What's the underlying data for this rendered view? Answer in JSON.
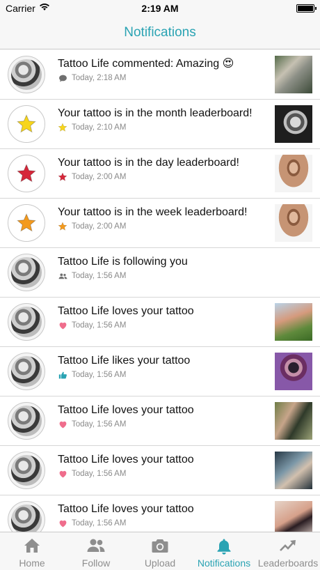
{
  "status_bar": {
    "carrier": "Carrier",
    "time": "2:19 AM"
  },
  "nav": {
    "title": "Notifications"
  },
  "notifications": [
    {
      "message": "Tattoo Life commented: Amazing 😍",
      "time": "Today, 2:18 AM",
      "meta_icon": "comment-icon",
      "avatar": "profile-photo",
      "thumb": "tattoo-arm-photo"
    },
    {
      "message": "Your tattoo is in the month leaderboard!",
      "time": "Today, 2:10 AM",
      "meta_icon": "star-icon",
      "avatar": "yellow-star",
      "thumb": "tattoo-face-photo"
    },
    {
      "message": "Your tattoo is in the day leaderboard!",
      "time": "Today, 2:00 AM",
      "meta_icon": "star-icon",
      "avatar": "red-star",
      "thumb": "tattoo-torso-photo"
    },
    {
      "message": "Your tattoo is in the week leaderboard!",
      "time": "Today, 2:00 AM",
      "meta_icon": "star-icon",
      "avatar": "orange-star",
      "thumb": "tattoo-torso-photo"
    },
    {
      "message": "Tattoo Life is following you",
      "time": "Today, 1:56 AM",
      "meta_icon": "people-icon",
      "avatar": "profile-photo",
      "thumb": ""
    },
    {
      "message": "Tattoo Life loves your tattoo",
      "time": "Today, 1:56 AM",
      "meta_icon": "heart-icon",
      "avatar": "profile-photo",
      "thumb": "tattoo-woman-photo"
    },
    {
      "message": "Tattoo Life likes your tattoo",
      "time": "Today, 1:56 AM",
      "meta_icon": "thumbs-up-icon",
      "avatar": "profile-photo",
      "thumb": "tattoo-flower-photo"
    },
    {
      "message": "Tattoo Life loves your tattoo",
      "time": "Today, 1:56 AM",
      "meta_icon": "heart-icon",
      "avatar": "profile-photo",
      "thumb": "tattoo-sleeve-photo"
    },
    {
      "message": "Tattoo Life loves your tattoo",
      "time": "Today, 1:56 AM",
      "meta_icon": "heart-icon",
      "avatar": "profile-photo",
      "thumb": "tattoo-leg-photo"
    },
    {
      "message": "Tattoo Life loves your tattoo",
      "time": "Today, 1:56 AM",
      "meta_icon": "heart-icon",
      "avatar": "profile-photo",
      "thumb": "tattoo-bikini-photo"
    }
  ],
  "tabs": [
    {
      "label": "Home",
      "icon": "home-icon",
      "active": false
    },
    {
      "label": "Follow",
      "icon": "people-icon",
      "active": false
    },
    {
      "label": "Upload",
      "icon": "camera-icon",
      "active": false
    },
    {
      "label": "Notifications",
      "icon": "bell-icon",
      "active": true
    },
    {
      "label": "Leaderboards",
      "icon": "trending-up-icon",
      "active": false
    }
  ],
  "colors": {
    "accent": "#2aa3b3",
    "tab_inactive": "#8e8e8e",
    "heart": "#ef6d8c",
    "thumbs": "#2aa3b3",
    "star_yellow": "#f7d51c",
    "star_red": "#d6273a",
    "star_orange": "#f39a1e"
  }
}
